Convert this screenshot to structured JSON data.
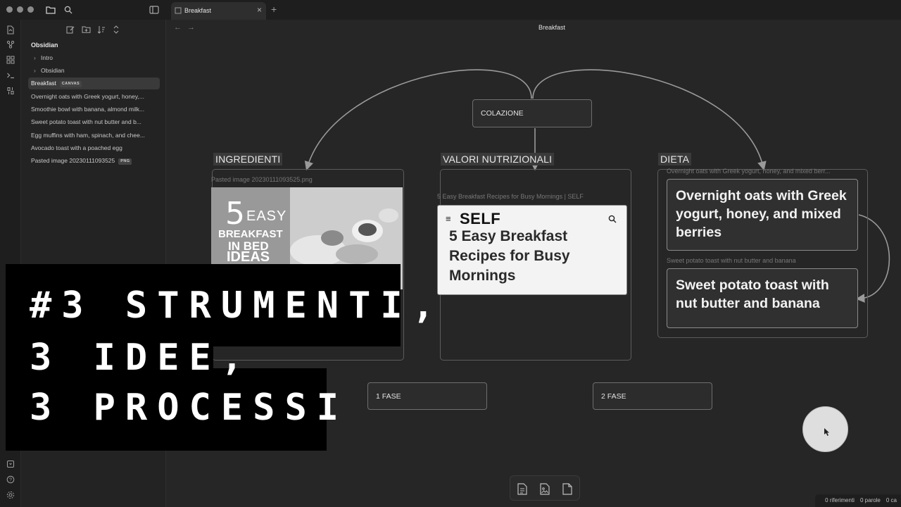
{
  "window": {
    "tab_title": "Breakfast",
    "tab_close": "×",
    "tab_add": "+"
  },
  "sidebar": {
    "vault_name": "Obsidian",
    "folders": [
      {
        "label": "Intro"
      },
      {
        "label": "Obsidian"
      }
    ],
    "files": [
      {
        "label": "Breakfast",
        "tag": "CANVAS",
        "active": true
      },
      {
        "label": "Overnight oats with Greek yogurt, honey,..."
      },
      {
        "label": "Smoothie bowl with banana, almond milk..."
      },
      {
        "label": "Sweet potato toast with nut butter and b..."
      },
      {
        "label": "Egg muffins with ham, spinach, and chee..."
      },
      {
        "label": "Avocado toast with a poached egg"
      },
      {
        "label": "Pasted image 20230111093525",
        "tag": "PNG"
      }
    ]
  },
  "canvas": {
    "title": "Breakfast",
    "nav_back": "←",
    "nav_forward": "→",
    "root_card": "COLAZIONE",
    "groups": [
      {
        "title": "INGREDIENTI",
        "file_label": "Pasted image 20230111093525.png"
      },
      {
        "title": "VALORI NUTRIZIONALI",
        "file_label": "5 Easy Breakfast Recipes for Busy Mornings | SELF"
      },
      {
        "title": "DIETA",
        "file_label": "Overnight oats with Greek yogurt, honey, and mixed berr..."
      }
    ],
    "image_card": {
      "big_number": "5",
      "word_easy": "EASY",
      "line_breakfast": "BREAKFAST",
      "line_in_bed": "IN BED",
      "line_ideas": "IDEAS"
    },
    "web_card": {
      "menu_glyph": "≡",
      "logo": "SELF",
      "headline": "5 Easy Breakfast Recipes for Busy Mornings"
    },
    "dieta_cards": [
      {
        "text": "Overnight oats with Greek yogurt, honey, and mixed berries"
      },
      {
        "caption": "Sweet potato toast with nut butter and banana",
        "text": "Sweet potato toast with nut butter and banana"
      }
    ],
    "phase_cards": [
      "1 FASE",
      "2 FASE"
    ]
  },
  "status_bar": {
    "backlinks": "0 riferimenti",
    "words": "0 parole",
    "chars": "0 ca"
  },
  "overlay": {
    "line1": "#3 STRUMENTI,",
    "line2": "3 IDEE,",
    "line3": "3 PROCESSI"
  },
  "icons": {
    "sidebar_toggle": "sidebar-toggle-icon",
    "files": "folder-icon",
    "search": "search-icon",
    "new_note": "edit-icon",
    "new_folder": "new-folder-icon",
    "sort": "sort-icon",
    "collapse": "collapse-icon",
    "ribbon": [
      "open-file-icon",
      "graph-icon",
      "canvas-icon",
      "terminal-icon",
      "templates-icon"
    ],
    "ribbon_bottom": [
      "vault-icon",
      "help-icon",
      "settings-icon"
    ],
    "canvas_tools": [
      "add-card-icon",
      "add-media-icon",
      "add-note-icon"
    ]
  },
  "colors": {
    "background": "#262626",
    "card_border": "#6e6e6e",
    "overlay": "#000000"
  }
}
